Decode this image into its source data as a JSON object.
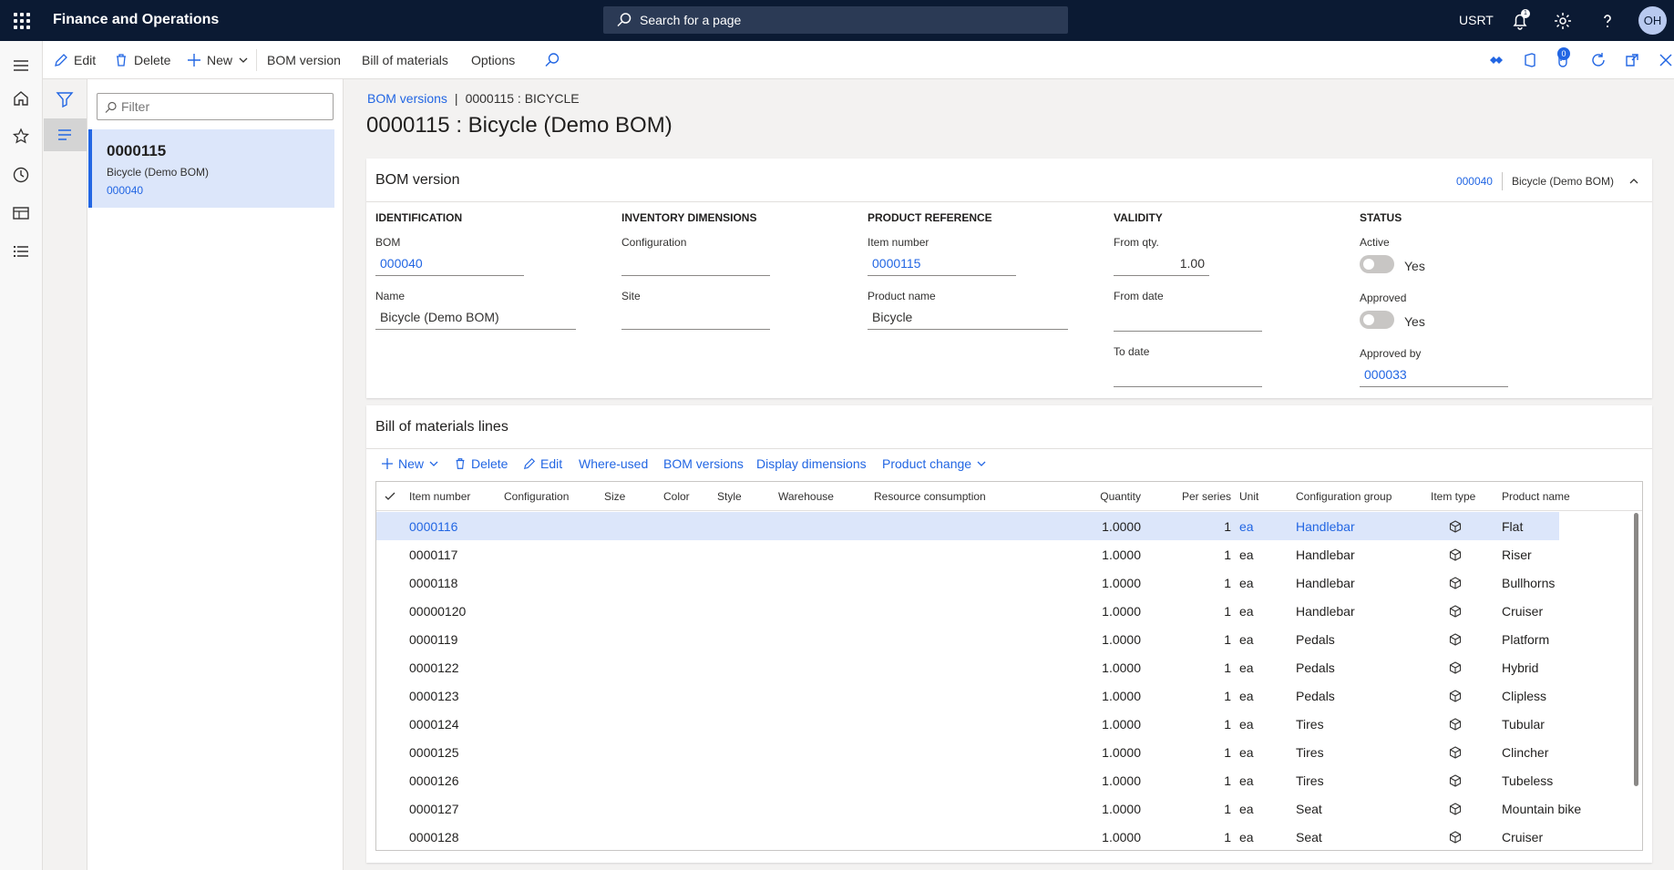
{
  "app": {
    "title": "Finance and Operations",
    "search_placeholder": "Search for a page",
    "company": "USRT",
    "avatar_initials": "OH",
    "notification_count": "1"
  },
  "actions": {
    "edit": "Edit",
    "delete": "Delete",
    "new": "New",
    "bom_version": "BOM version",
    "bill_of_materials": "Bill of materials",
    "options": "Options",
    "badge": "0"
  },
  "list": {
    "filter_placeholder": "Filter",
    "card": {
      "title": "0000115",
      "subtitle": "Bicycle (Demo BOM)",
      "link": "000040"
    }
  },
  "breadcrumb": {
    "link": "BOM versions",
    "current": "0000115 : BICYCLE"
  },
  "page_title": "0000115 : Bicycle (Demo BOM)",
  "bom_version": {
    "title": "BOM version",
    "summary_link": "000040",
    "summary_text": "Bicycle (Demo BOM)",
    "identification": {
      "title": "Identification",
      "bom_label": "BOM",
      "bom_value": "000040",
      "name_label": "Name",
      "name_value": "Bicycle (Demo BOM)"
    },
    "inventory": {
      "title": "Inventory dimensions",
      "config_label": "Configuration",
      "config_value": "",
      "site_label": "Site",
      "site_value": ""
    },
    "product": {
      "title": "Product reference",
      "item_label": "Item number",
      "item_value": "0000115",
      "name_label": "Product name",
      "name_value": "Bicycle"
    },
    "validity": {
      "title": "Validity",
      "from_qty_label": "From qty.",
      "from_qty_value": "1.00",
      "from_date_label": "From date",
      "from_date_value": "",
      "to_date_label": "To date",
      "to_date_value": ""
    },
    "status": {
      "title": "Status",
      "active_label": "Active",
      "active_value": "Yes",
      "approved_label": "Approved",
      "approved_value": "Yes",
      "approved_by_label": "Approved by",
      "approved_by_value": "000033"
    }
  },
  "lines": {
    "title": "Bill of materials lines",
    "actions": {
      "new": "New",
      "delete": "Delete",
      "edit": "Edit",
      "where_used": "Where-used",
      "bom_versions": "BOM versions",
      "display_dimensions": "Display dimensions",
      "product_change": "Product change"
    },
    "columns": {
      "item_number": "Item number",
      "configuration": "Configuration",
      "size": "Size",
      "color": "Color",
      "style": "Style",
      "warehouse": "Warehouse",
      "resource_consumption": "Resource consumption",
      "quantity": "Quantity",
      "per_series": "Per series",
      "unit": "Unit",
      "config_group": "Configuration group",
      "item_type": "Item type",
      "product_name": "Product name"
    },
    "rows": [
      {
        "item": "0000116",
        "qty": "1.0000",
        "per": "1",
        "unit": "ea",
        "group": "Handlebar",
        "product": "Flat"
      },
      {
        "item": "0000117",
        "qty": "1.0000",
        "per": "1",
        "unit": "ea",
        "group": "Handlebar",
        "product": "Riser"
      },
      {
        "item": "0000118",
        "qty": "1.0000",
        "per": "1",
        "unit": "ea",
        "group": "Handlebar",
        "product": "Bullhorns"
      },
      {
        "item": "00000120",
        "qty": "1.0000",
        "per": "1",
        "unit": "ea",
        "group": "Handlebar",
        "product": "Cruiser"
      },
      {
        "item": "0000119",
        "qty": "1.0000",
        "per": "1",
        "unit": "ea",
        "group": "Pedals",
        "product": "Platform"
      },
      {
        "item": "0000122",
        "qty": "1.0000",
        "per": "1",
        "unit": "ea",
        "group": "Pedals",
        "product": "Hybrid"
      },
      {
        "item": "0000123",
        "qty": "1.0000",
        "per": "1",
        "unit": "ea",
        "group": "Pedals",
        "product": "Clipless"
      },
      {
        "item": "0000124",
        "qty": "1.0000",
        "per": "1",
        "unit": "ea",
        "group": "Tires",
        "product": "Tubular"
      },
      {
        "item": "0000125",
        "qty": "1.0000",
        "per": "1",
        "unit": "ea",
        "group": "Tires",
        "product": "Clincher"
      },
      {
        "item": "0000126",
        "qty": "1.0000",
        "per": "1",
        "unit": "ea",
        "group": "Tires",
        "product": "Tubeless"
      },
      {
        "item": "0000127",
        "qty": "1.0000",
        "per": "1",
        "unit": "ea",
        "group": "Seat",
        "product": "Mountain bike"
      },
      {
        "item": "0000128",
        "qty": "1.0000",
        "per": "1",
        "unit": "ea",
        "group": "Seat",
        "product": "Cruiser"
      }
    ]
  },
  "colors": {
    "topbar": "#0b1a33",
    "accent": "#2266e3",
    "selected_row": "#dce6fa"
  },
  "icons": [
    "waffle-icon",
    "search-icon",
    "bell-icon",
    "gear-icon",
    "help-icon",
    "hamburger-icon",
    "home-icon",
    "star-icon",
    "clock-icon",
    "workspace-icon",
    "list-icon",
    "filter-icon",
    "edit-icon",
    "delete-icon",
    "plus-icon",
    "chevron-down-icon",
    "chevron-up-icon",
    "package-icon"
  ]
}
